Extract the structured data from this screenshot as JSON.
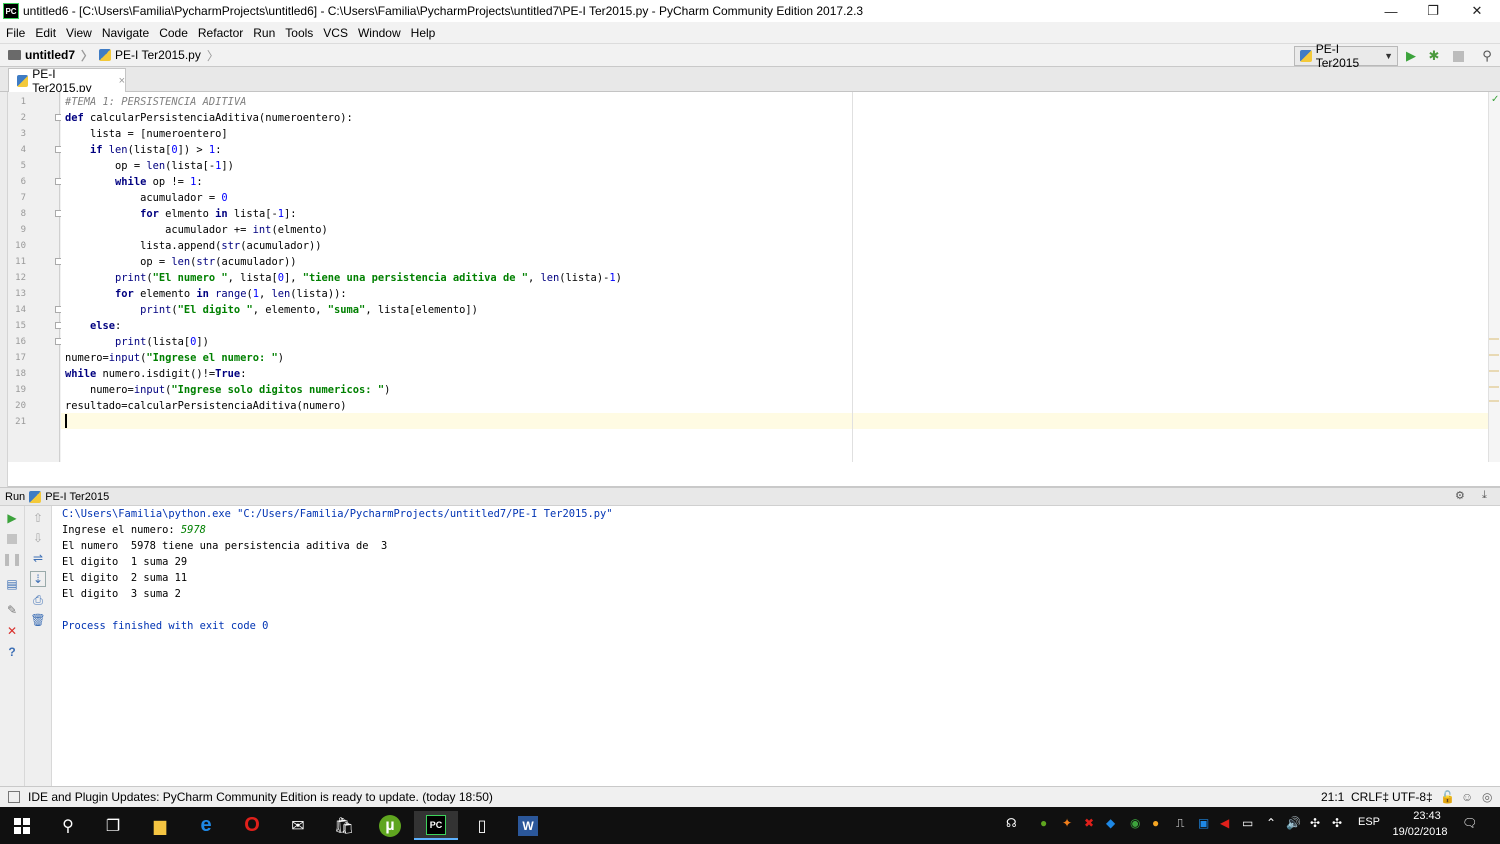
{
  "window": {
    "title": "untitled6 - [C:\\Users\\Familia\\PycharmProjects\\untitled6] - C:\\Users\\Familia\\PycharmProjects\\untitled7\\PE-I Ter2015.py - PyCharm Community Edition 2017.2.3",
    "app_icon": "PC",
    "minimize": "—",
    "restore": "❐",
    "close": "✕"
  },
  "menu": [
    "File",
    "Edit",
    "View",
    "Navigate",
    "Code",
    "Refactor",
    "Run",
    "Tools",
    "VCS",
    "Window",
    "Help"
  ],
  "navbar": {
    "project": "untitled7",
    "file": "PE-I Ter2015.py",
    "run_config": "PE-I Ter2015"
  },
  "tab": {
    "label": "PE-I Ter2015.py",
    "close": "×"
  },
  "editor": {
    "line_numbers": [
      "1",
      "2",
      "3",
      "4",
      "5",
      "6",
      "7",
      "8",
      "9",
      "10",
      "11",
      "12",
      "13",
      "14",
      "15",
      "16",
      "17",
      "18",
      "19",
      "20",
      "21"
    ],
    "lines": [
      [
        [
          "cm",
          "#TEMA 1: PERSISTENCIA ADITIVA"
        ]
      ],
      [
        [
          "kw",
          "def "
        ],
        [
          "",
          "calcularPersistenciaAditiva(numeroentero):"
        ]
      ],
      [
        [
          "",
          "    lista = [numeroentero]"
        ]
      ],
      [
        [
          "kw",
          "    if "
        ],
        [
          "bi",
          "len"
        ],
        [
          "",
          "(lista["
        ],
        [
          "nu",
          "0"
        ],
        [
          "",
          "]) > "
        ],
        [
          "nu",
          "1"
        ],
        [
          "",
          ":"
        ]
      ],
      [
        [
          "",
          "        op = "
        ],
        [
          "bi",
          "len"
        ],
        [
          "",
          "(lista[-"
        ],
        [
          "nu",
          "1"
        ],
        [
          "",
          "])"
        ]
      ],
      [
        [
          "kw",
          "        while "
        ],
        [
          "",
          "op != "
        ],
        [
          "nu",
          "1"
        ],
        [
          "",
          ":"
        ]
      ],
      [
        [
          "",
          "            acumulador = "
        ],
        [
          "nu",
          "0"
        ]
      ],
      [
        [
          "kw",
          "            for "
        ],
        [
          "",
          "elmento "
        ],
        [
          "kw",
          "in "
        ],
        [
          "",
          "lista[-"
        ],
        [
          "nu",
          "1"
        ],
        [
          "",
          "]:"
        ]
      ],
      [
        [
          "",
          "                acumulador += "
        ],
        [
          "bi",
          "int"
        ],
        [
          "",
          "(elmento)"
        ]
      ],
      [
        [
          "",
          "            lista.append("
        ],
        [
          "bi",
          "str"
        ],
        [
          "",
          "(acumulador))"
        ]
      ],
      [
        [
          "",
          "            op = "
        ],
        [
          "bi",
          "len"
        ],
        [
          "",
          "("
        ],
        [
          "bi",
          "str"
        ],
        [
          "",
          "(acumulador))"
        ]
      ],
      [
        [
          "bi",
          "        print"
        ],
        [
          "",
          "("
        ],
        [
          "st",
          "\"El numero \""
        ],
        [
          "",
          ", lista["
        ],
        [
          "nu",
          "0"
        ],
        [
          "",
          "], "
        ],
        [
          "st",
          "\"tiene una persistencia aditiva de \""
        ],
        [
          "",
          ", "
        ],
        [
          "bi",
          "len"
        ],
        [
          "",
          "(lista)-"
        ],
        [
          "nu",
          "1"
        ],
        [
          "",
          ")"
        ]
      ],
      [
        [
          "kw",
          "        for "
        ],
        [
          "",
          "elemento "
        ],
        [
          "kw",
          "in "
        ],
        [
          "bi",
          "range"
        ],
        [
          "",
          "("
        ],
        [
          "nu",
          "1"
        ],
        [
          "",
          ", "
        ],
        [
          "bi",
          "len"
        ],
        [
          "",
          "(lista)):"
        ]
      ],
      [
        [
          "bi",
          "            print"
        ],
        [
          "",
          "("
        ],
        [
          "st",
          "\"El digito \""
        ],
        [
          "",
          ", elemento, "
        ],
        [
          "st",
          "\"suma\""
        ],
        [
          "",
          ", lista[elemento])"
        ]
      ],
      [
        [
          "kw",
          "    else"
        ],
        [
          "",
          ":"
        ]
      ],
      [
        [
          "bi",
          "        print"
        ],
        [
          "",
          "(lista["
        ],
        [
          "nu",
          "0"
        ],
        [
          "",
          "])"
        ]
      ],
      [
        [
          "",
          "numero="
        ],
        [
          "bi",
          "input"
        ],
        [
          "",
          "("
        ],
        [
          "st",
          "\"Ingrese el numero: \""
        ],
        [
          "",
          ")"
        ]
      ],
      [
        [
          "kw",
          "while "
        ],
        [
          "",
          "numero.isdigit()!="
        ],
        [
          "kw",
          "True"
        ],
        [
          "",
          ":"
        ]
      ],
      [
        [
          "",
          "    numero="
        ],
        [
          "bi",
          "input"
        ],
        [
          "",
          "("
        ],
        [
          "st",
          "\"Ingrese solo digitos numericos: \""
        ],
        [
          "",
          ")"
        ]
      ],
      [
        [
          "",
          "resultado=calcularPersistenciaAditiva(numero)"
        ]
      ],
      [
        [
          "",
          ""
        ]
      ]
    ],
    "cursor": "21:1"
  },
  "run": {
    "label": "Run",
    "config": "PE-I Ter2015",
    "console": {
      "command": "C:\\Users\\Familia\\python.exe \"C:/Users/Familia/PycharmProjects/untitled7/PE-I Ter2015.py\"",
      "prompt": "Ingrese el numero: ",
      "input": "5978",
      "out1": "El numero  5978 tiene una persistencia aditiva de  3",
      "out2": "El digito  1 suma 29",
      "out3": "El digito  2 suma 11",
      "out4": "El digito  3 suma 2",
      "exit": "Process finished with exit code 0"
    }
  },
  "status": {
    "message": "IDE and Plugin Updates: PyCharm Community Edition is ready to update. (today 18:50)",
    "position": "21:1",
    "line_sep": "CRLF‡",
    "encoding": "UTF-8‡"
  },
  "taskbar": {
    "time": "23:43",
    "date": "19/02/2018",
    "lang": "ESP"
  },
  "colors": {
    "keyword": "#000080",
    "string": "#008000",
    "number": "#0000ff",
    "comment": "#808080",
    "run_green": "#3ca33c",
    "stop_red": "#d9302c"
  }
}
